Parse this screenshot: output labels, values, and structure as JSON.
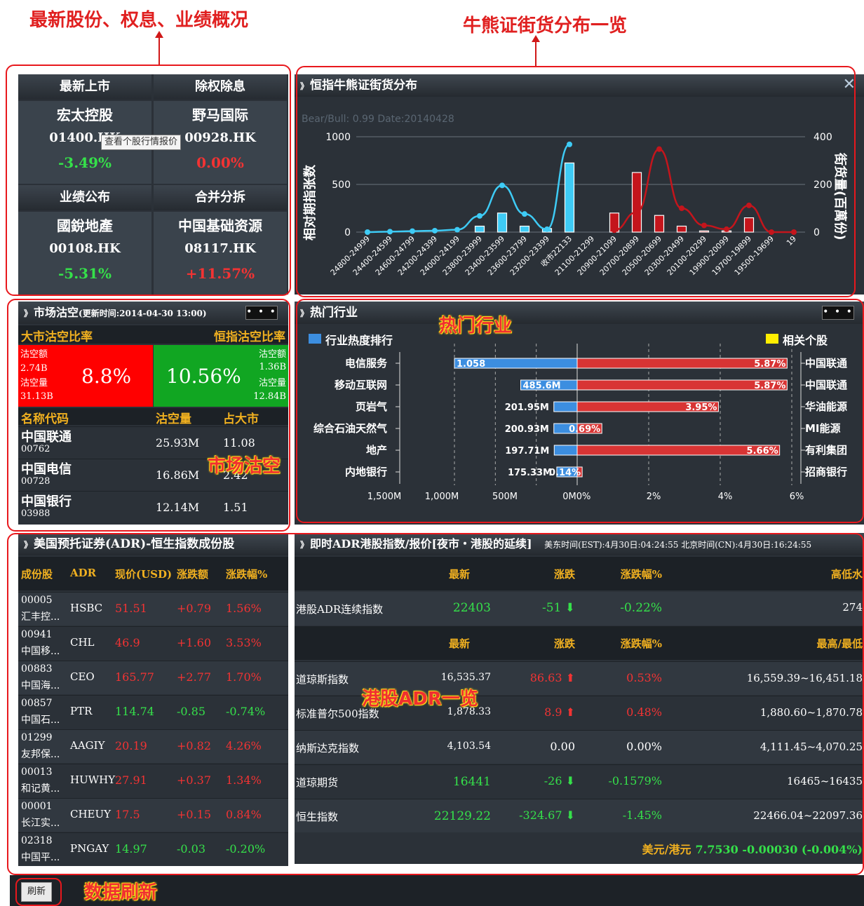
{
  "annotations": {
    "top_left": "最新股份、权息、业绩概况",
    "top_right": "牛熊证街货分布一览",
    "hot_industry": "热门行业",
    "short_selling": "市场沽空",
    "adr": "港股ADR一览",
    "refresh": "数据刷新"
  },
  "overview": {
    "tooltip": "查看个股行情报价",
    "cards": [
      {
        "header": "最新上市",
        "name": "宏太控股",
        "code": "01400.HK",
        "change": "-3.49%",
        "color": "#35e04a"
      },
      {
        "header": "除权除息",
        "name": "野马国际",
        "code": "00928.HK",
        "change": "0.00%",
        "color": "#f23333"
      },
      {
        "header": "业绩公布",
        "name": "國銳地產",
        "code": "00108.HK",
        "change": "-5.31%",
        "color": "#35e04a"
      },
      {
        "header": "合并分拆",
        "name": "中国基础资源",
        "code": "08117.HK",
        "change": "+11.57%",
        "color": "#f23333"
      }
    ]
  },
  "cbbc": {
    "title": "恒指牛熊证街货分布",
    "close": "✕",
    "subtitle": "Bear/Bull: 0.99 Date:20140428",
    "ylabel": "相对期指张数",
    "y2label": "街货量(百萬份)"
  },
  "chart_data": {
    "type": "bar",
    "categories": [
      "24800-24999",
      "24400-24599",
      "24600-24799",
      "24200-24399",
      "24000-24199",
      "23800-23999",
      "23400-23599",
      "23600-23799",
      "23200-23399",
      "收市22133",
      "21100-21299",
      "20900-21099",
      "20700-20899",
      "20500-20699",
      "20300-20499",
      "20100-20299",
      "19900-20099",
      "19700-19899",
      "19500-19699",
      "19"
    ],
    "ylim": [
      0,
      1000
    ],
    "y2lim": [
      0,
      400
    ],
    "yticks": [
      0,
      500,
      1000
    ],
    "y2ticks": [
      0,
      200,
      400
    ],
    "series": [
      {
        "color": "#ffffff",
        "bar_fill_cyan": "#3ecbf5",
        "bar_fill_red": "#c4151c",
        "bars": [
          0,
          0,
          0,
          0,
          0,
          25,
          80,
          25,
          15,
          290,
          0,
          80,
          250,
          70,
          25,
          5,
          5,
          60,
          0,
          0
        ],
        "axis": "y2"
      },
      {
        "color": "#3ecbf5",
        "values": [
          0,
          5,
          10,
          15,
          25,
          170,
          490,
          190,
          30,
          920,
          null,
          null,
          null,
          null,
          null,
          null,
          null,
          null,
          null,
          null
        ],
        "axis": "y"
      },
      {
        "color": "#c4151c",
        "values": [
          null,
          null,
          null,
          null,
          null,
          null,
          null,
          null,
          null,
          null,
          null,
          20,
          210,
          870,
          250,
          70,
          30,
          280,
          0,
          0
        ],
        "axis": "y"
      }
    ]
  },
  "short": {
    "title": "市场沽空",
    "title_small": "(更新时间:2014-04-30 13:00)",
    "dots": "• • •",
    "left_label": "大市沽空比率",
    "right_label": "恒指沽空比率",
    "left_amt_label": "沽空额",
    "left_amt": "2.74B",
    "left_vol_label": "沽空量",
    "left_vol": "31.13B",
    "left_pct": "8.8%",
    "right_pct": "10.56%",
    "right_amt_label": "沽空额",
    "right_amt": "1.36B",
    "right_vol_label": "沽空量",
    "right_vol": "12.84B",
    "cols": [
      "名称代码",
      "沽空量",
      "占大市"
    ],
    "rows": [
      {
        "name": "中国联通",
        "code": "00762",
        "vol": "25.93M",
        "pct": "11.08"
      },
      {
        "name": "中国电信",
        "code": "00728",
        "vol": "16.86M",
        "pct": "2.42"
      },
      {
        "name": "中国银行",
        "code": "03988",
        "vol": "12.14M",
        "pct": "1.51"
      }
    ]
  },
  "industry": {
    "title": "热门行业",
    "dots": "• • •",
    "legend_left": "行业热度排行",
    "legend_right": "相关个股",
    "rows": [
      {
        "name": "电信服务",
        "amount": "1.058",
        "amount_frac": 1.0,
        "pct": "5.87%",
        "pct_val": 5.87,
        "stock": "中国联通"
      },
      {
        "name": "移动互联网",
        "amount": "485.6M",
        "amount_frac": 0.46,
        "pct": "5.87%",
        "pct_val": 5.87,
        "stock": "中国联通"
      },
      {
        "name": "页岩气",
        "amount": "201.95M",
        "amount_frac": 0.19,
        "pct": "3.95%",
        "pct_val": 3.95,
        "stock": "华油能源"
      },
      {
        "name": "综合石油天然气",
        "amount": "200.93M",
        "amount_frac": 0.19,
        "pct": "0.69%",
        "pct_val": 0.69,
        "stock": "MI能源"
      },
      {
        "name": "地产",
        "amount": "197.71M",
        "amount_frac": 0.187,
        "pct": "5.66%",
        "pct_val": 5.66,
        "stock": "有利集团"
      },
      {
        "name": "内地银行",
        "amount": "175.33M",
        "amount_frac": 0.166,
        "pct": "0.14%",
        "pct_val": 0.14,
        "stock": "招商银行"
      }
    ],
    "xticks_left": [
      "1,500M",
      "1,000M",
      "500M",
      "0M"
    ],
    "xticks_right": [
      "0%",
      "2%",
      "4%",
      "6%"
    ]
  },
  "adr": {
    "title": "美国预托证券(ADR)-恒生指数成份股",
    "cols": [
      "成份股",
      "ADR",
      "现价(USD)",
      "涨跌额",
      "涨跌幅%"
    ],
    "rows": [
      {
        "code": "00005",
        "name": "汇丰控...",
        "adr": "HSBC",
        "price": "51.51",
        "chg": "+0.79",
        "pct": "1.56%",
        "color": "#f23333"
      },
      {
        "code": "00941",
        "name": "中国移...",
        "adr": "CHL",
        "price": "46.9",
        "chg": "+1.60",
        "pct": "3.53%",
        "color": "#f23333"
      },
      {
        "code": "00883",
        "name": "中国海...",
        "adr": "CEO",
        "price": "165.77",
        "chg": "+2.77",
        "pct": "1.70%",
        "color": "#f23333"
      },
      {
        "code": "00857",
        "name": "中国石...",
        "adr": "PTR",
        "price": "114.74",
        "chg": "-0.85",
        "pct": "-0.74%",
        "color": "#35e04a"
      },
      {
        "code": "01299",
        "name": "友邦保...",
        "adr": "AAGIY",
        "price": "20.19",
        "chg": "+0.82",
        "pct": "4.26%",
        "color": "#f23333"
      },
      {
        "code": "00013",
        "name": "和记黄...",
        "adr": "HUWHY",
        "price": "27.91",
        "chg": "+0.37",
        "pct": "1.34%",
        "color": "#f23333"
      },
      {
        "code": "00001",
        "name": "长江实...",
        "adr": "CHEUY",
        "price": "17.5",
        "chg": "+0.15",
        "pct": "0.84%",
        "color": "#f23333"
      },
      {
        "code": "02318",
        "name": "中国平...",
        "adr": "PNGAY",
        "price": "14.97",
        "chg": "-0.03",
        "pct": "-0.20%",
        "color": "#35e04a"
      }
    ]
  },
  "indices": {
    "title": "即时ADR港股指数/报价[夜市・港股的延续]",
    "time": "美东时间(EST):4月30日:04:24:55 北京时间(CN):4月30日:16:24:55",
    "hdr1": [
      "最新",
      "涨跌",
      "涨跌幅%",
      "高低水"
    ],
    "row1": {
      "name": "港股ADR连续指数",
      "last": "22403",
      "chg": "-51 ⬇",
      "pct": "-0.22%",
      "extra": "274",
      "color": "#35e04a"
    },
    "hdr2": [
      "最新",
      "涨跌",
      "涨跌幅%",
      "最高/最低"
    ],
    "rows": [
      {
        "name": "道琼斯指数",
        "last": "16,535.37",
        "chg": "86.63 ⬆",
        "pct": "0.53%",
        "hl": "16,559.39~16,451.18",
        "color": "#f23333",
        "lastcolor": "#ffffff"
      },
      {
        "name": "标准普尔500指数",
        "last": "1,878.33",
        "chg": "8.9 ⬆",
        "pct": "0.48%",
        "hl": "1,880.60~1,870.78",
        "color": "#f23333",
        "lastcolor": "#ffffff"
      },
      {
        "name": "纳斯达克指数",
        "last": "4,103.54",
        "chg": "0.00",
        "pct": "0.00%",
        "hl": "4,111.45~4,070.25",
        "color": "#ffffff",
        "lastcolor": "#ffffff"
      },
      {
        "name": "道琼期货",
        "last": "16441",
        "chg": "-26 ⬇",
        "pct": "-0.1579%",
        "hl": "16465~16435",
        "color": "#35e04a",
        "lastcolor": "#35e04a"
      },
      {
        "name": "恒生指数",
        "last": "22129.22",
        "chg": "-324.67 ⬇",
        "pct": "-1.45%",
        "hl": "22466.04~22097.36",
        "color": "#35e04a",
        "lastcolor": "#35e04a"
      }
    ],
    "fx_label": "美元/港元",
    "fx_value": "7.7530 -0.00030 (-0.004%)"
  },
  "refresh": {
    "label": "刷新"
  }
}
